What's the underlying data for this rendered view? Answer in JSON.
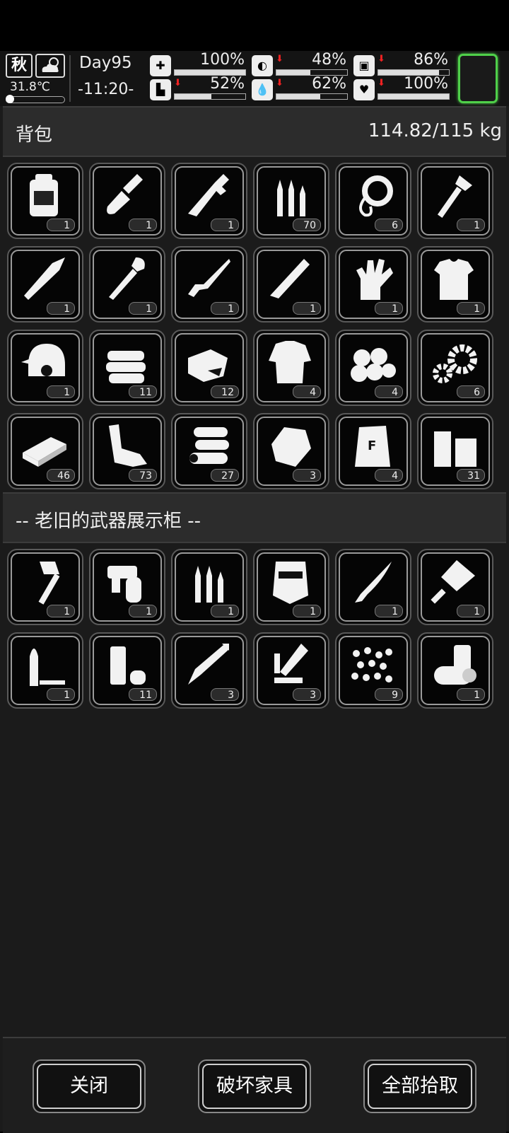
{
  "hud": {
    "season": "秋",
    "temperature": "31.8℃",
    "temperature_level": 0.1,
    "day": "Day95",
    "time": "-11:20-",
    "stats": [
      {
        "icon": "medkit-icon",
        "glyph": "✚",
        "value": "100%",
        "level": 1.0,
        "decreasing": false
      },
      {
        "icon": "stomach-icon",
        "glyph": "◐",
        "value": "48%",
        "level": 0.48,
        "decreasing": true
      },
      {
        "icon": "mind-icon",
        "glyph": "▣",
        "value": "86%",
        "level": 0.86,
        "decreasing": true
      },
      {
        "icon": "boot-icon",
        "glyph": "▙",
        "value": "52%",
        "level": 0.52,
        "decreasing": true
      },
      {
        "icon": "water-drop-icon",
        "glyph": "💧",
        "value": "62%",
        "level": 0.62,
        "decreasing": true
      },
      {
        "icon": "heart-icon",
        "glyph": "♥",
        "value": "100%",
        "level": 1.0,
        "decreasing": true
      }
    ],
    "accent_color": "#4fd04a"
  },
  "backpack": {
    "title": "背包",
    "weight": "114.82/115 kg",
    "items": [
      {
        "icon": "backpack-icon",
        "count": "1"
      },
      {
        "icon": "shovel-icon",
        "count": "1"
      },
      {
        "icon": "wrench-icon",
        "count": "1"
      },
      {
        "icon": "ammo-icon",
        "count": "70"
      },
      {
        "icon": "rope-icon",
        "count": "6"
      },
      {
        "icon": "hatchet-icon",
        "count": "1"
      },
      {
        "icon": "spear-icon",
        "count": "1"
      },
      {
        "icon": "spade-icon",
        "count": "1"
      },
      {
        "icon": "rifle-icon",
        "count": "1"
      },
      {
        "icon": "machete-icon",
        "count": "1"
      },
      {
        "icon": "glove-icon",
        "count": "1"
      },
      {
        "icon": "body-armor-icon",
        "count": "1"
      },
      {
        "icon": "helmet-icon",
        "count": "1"
      },
      {
        "icon": "cloth-icon",
        "count": "11"
      },
      {
        "icon": "meat-icon",
        "count": "12"
      },
      {
        "icon": "rag-shirt-icon",
        "count": "4"
      },
      {
        "icon": "cotton-balls-icon",
        "count": "4"
      },
      {
        "icon": "gears-icon",
        "count": "6"
      },
      {
        "icon": "ingot-icon",
        "count": "46"
      },
      {
        "icon": "scrap-icon",
        "count": "73"
      },
      {
        "icon": "logs-icon",
        "count": "27"
      },
      {
        "icon": "stone-icon",
        "count": "3"
      },
      {
        "icon": "flour-sack-icon",
        "count": "4"
      },
      {
        "icon": "planks-icon",
        "count": "31"
      }
    ]
  },
  "container": {
    "title": "-- 老旧的武器展示柜 --",
    "items": [
      {
        "icon": "fire-axe-icon",
        "count": "1"
      },
      {
        "icon": "blowtorch-icon",
        "count": "1"
      },
      {
        "icon": "ammo-icon",
        "count": "1"
      },
      {
        "icon": "riot-shield-icon",
        "count": "1"
      },
      {
        "icon": "knife-icon",
        "count": "1"
      },
      {
        "icon": "cleaver-icon",
        "count": "1"
      },
      {
        "icon": "bullet-icon",
        "count": "1"
      },
      {
        "icon": "shotgun-shell-icon",
        "count": "11"
      },
      {
        "icon": "arrow-icon",
        "count": "3"
      },
      {
        "icon": "rocket-icon",
        "count": "3"
      },
      {
        "icon": "pellets-icon",
        "count": "9"
      },
      {
        "icon": "can-icon",
        "count": "1"
      }
    ]
  },
  "buttons": {
    "close": "关闭",
    "destroy": "破坏家具",
    "take_all": "全部拾取"
  }
}
